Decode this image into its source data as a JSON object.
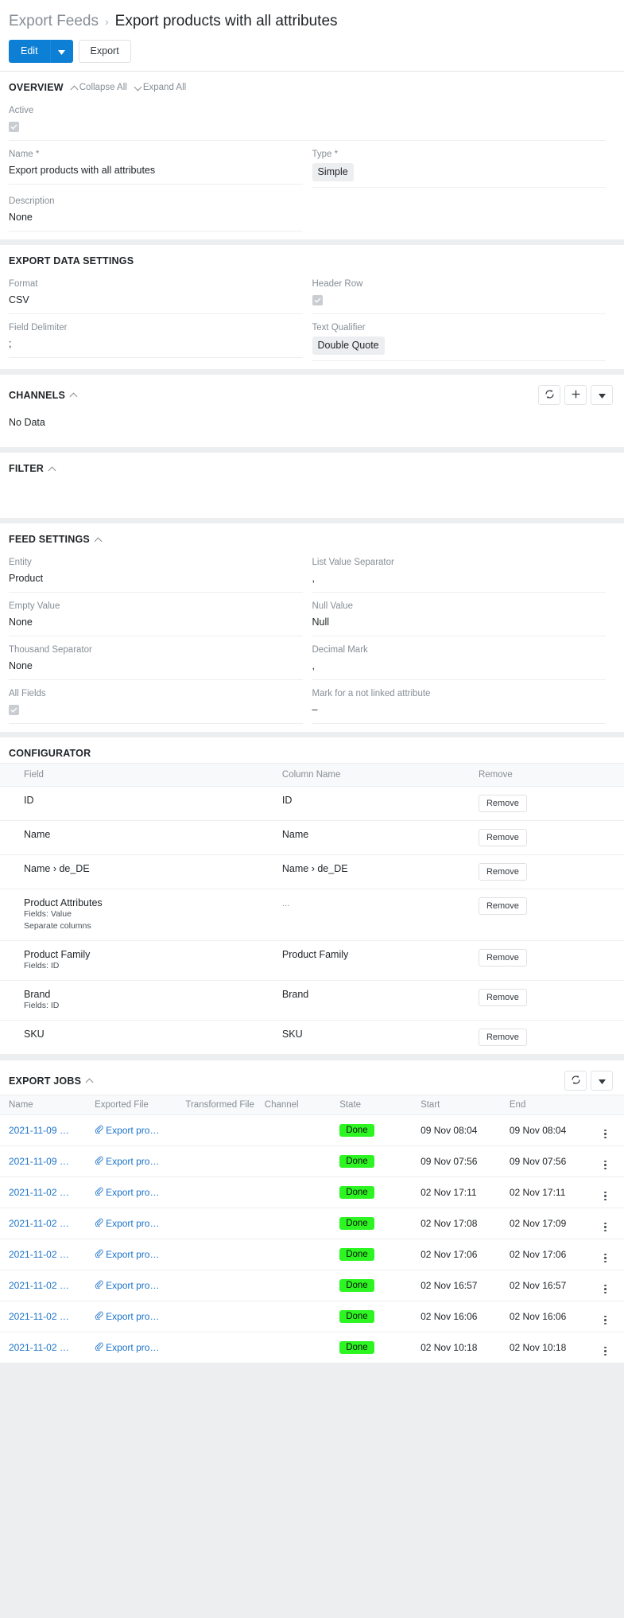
{
  "breadcrumb": {
    "parent": "Export Feeds",
    "separator": "›",
    "current": "Export products with all attributes"
  },
  "toolbar": {
    "edit_label": "Edit",
    "export_label": "Export"
  },
  "overview": {
    "title": "OVERVIEW",
    "collapse_all": "Collapse All",
    "expand_all": "Expand All",
    "fields": [
      {
        "label": "Active",
        "value": "",
        "type": "checkbox",
        "checked": true
      },
      {
        "label": "Name *",
        "value": "Export products with all attributes",
        "type": "text"
      },
      {
        "label": "Type *",
        "value": "Simple",
        "type": "chip"
      },
      {
        "label": "Description",
        "value": "None",
        "type": "text"
      }
    ]
  },
  "export_data_settings": {
    "title": "EXPORT DATA SETTINGS",
    "fields": [
      {
        "label": "Format",
        "value": "CSV",
        "type": "text"
      },
      {
        "label": "Header Row",
        "value": "",
        "type": "checkbox",
        "checked": true
      },
      {
        "label": "Field Delimiter",
        "value": ";",
        "type": "text"
      },
      {
        "label": "Text Qualifier",
        "value": "Double Quote",
        "type": "chip"
      }
    ]
  },
  "channels": {
    "title": "CHANNELS",
    "no_data": "No Data",
    "actions": [
      "refresh-icon",
      "plus-icon",
      "caret-down-icon"
    ]
  },
  "filter": {
    "title": "FILTER"
  },
  "feed_settings": {
    "title": "FEED SETTINGS",
    "fields": [
      {
        "label": "Entity",
        "value": "Product",
        "type": "text"
      },
      {
        "label": "List Value Separator",
        "value": ",",
        "type": "text"
      },
      {
        "label": "Empty Value",
        "value": "None",
        "type": "text"
      },
      {
        "label": "Null Value",
        "value": "Null",
        "type": "text"
      },
      {
        "label": "Thousand Separator",
        "value": "None",
        "type": "text"
      },
      {
        "label": "Decimal Mark",
        "value": ",",
        "type": "text"
      },
      {
        "label": "All Fields",
        "value": "",
        "type": "checkbox",
        "checked": true
      },
      {
        "label": "Mark for a not linked attribute",
        "value": "–",
        "type": "text"
      }
    ]
  },
  "configurator": {
    "title": "CONFIGURATOR",
    "columns": [
      "Field",
      "Column Name",
      "Remove"
    ],
    "remove_label": "Remove",
    "rows": [
      {
        "field": "ID",
        "field_sub": "",
        "field_sub2": "",
        "column": "ID"
      },
      {
        "field": "Name",
        "field_sub": "",
        "field_sub2": "",
        "column": "Name"
      },
      {
        "field": "Name › de_DE",
        "field_sub": "",
        "field_sub2": "",
        "column": "Name › de_DE"
      },
      {
        "field": "Product Attributes",
        "field_sub": "Fields: Value",
        "field_sub2": "Separate columns",
        "column": "..."
      },
      {
        "field": "Product Family",
        "field_sub": "Fields: ID",
        "field_sub2": "",
        "column": "Product Family"
      },
      {
        "field": "Brand",
        "field_sub": "Fields: ID",
        "field_sub2": "",
        "column": "Brand"
      },
      {
        "field": "SKU",
        "field_sub": "",
        "field_sub2": "",
        "column": "SKU"
      }
    ]
  },
  "export_jobs": {
    "title": "EXPORT JOBS",
    "actions": [
      "refresh-icon",
      "caret-down-icon"
    ],
    "columns": [
      "Name",
      "Exported File",
      "Transformed File",
      "Channel",
      "State",
      "Start",
      "End"
    ],
    "rows": [
      {
        "name": "2021-11-09 …",
        "file": "Export pro…",
        "transformed": "",
        "channel": "",
        "state": "Done",
        "start": "09 Nov 08:04",
        "end": "09 Nov 08:04"
      },
      {
        "name": "2021-11-09 …",
        "file": "Export pro…",
        "transformed": "",
        "channel": "",
        "state": "Done",
        "start": "09 Nov 07:56",
        "end": "09 Nov 07:56"
      },
      {
        "name": "2021-11-02 …",
        "file": "Export pro…",
        "transformed": "",
        "channel": "",
        "state": "Done",
        "start": "02 Nov 17:11",
        "end": "02 Nov 17:11"
      },
      {
        "name": "2021-11-02 …",
        "file": "Export pro…",
        "transformed": "",
        "channel": "",
        "state": "Done",
        "start": "02 Nov 17:08",
        "end": "02 Nov 17:09"
      },
      {
        "name": "2021-11-02 …",
        "file": "Export pro…",
        "transformed": "",
        "channel": "",
        "state": "Done",
        "start": "02 Nov 17:06",
        "end": "02 Nov 17:06"
      },
      {
        "name": "2021-11-02 …",
        "file": "Export pro…",
        "transformed": "",
        "channel": "",
        "state": "Done",
        "start": "02 Nov 16:57",
        "end": "02 Nov 16:57"
      },
      {
        "name": "2021-11-02 …",
        "file": "Export pro…",
        "transformed": "",
        "channel": "",
        "state": "Done",
        "start": "02 Nov 16:06",
        "end": "02 Nov 16:06"
      },
      {
        "name": "2021-11-02 …",
        "file": "Export pro…",
        "transformed": "",
        "channel": "",
        "state": "Done",
        "start": "02 Nov 10:18",
        "end": "02 Nov 10:18"
      }
    ]
  },
  "colors": {
    "accent": "#0d7fd4",
    "link": "#1a73c9",
    "done_badge": "#2cf522",
    "muted": "#868e96"
  }
}
